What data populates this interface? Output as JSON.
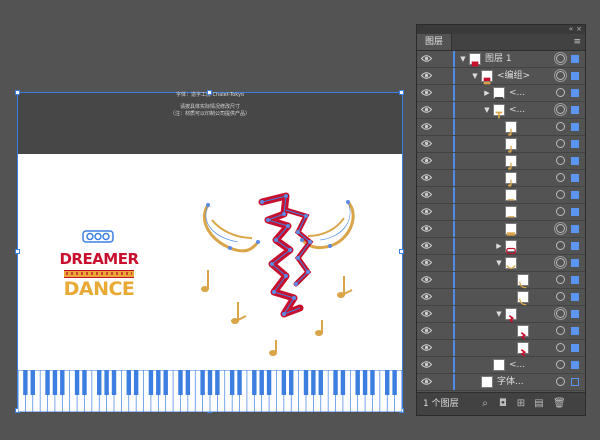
{
  "artboard": {
    "annotation_line1": "字体：造字工房 Chalet-Tokyo",
    "annotation_line2": "请按具体实际情况修改尺寸",
    "annotation_line3": "（注：材质可以印制公司提供产品）",
    "logo_text_top": "DREAMER",
    "logo_text_bottom": "DANCE",
    "colors": {
      "selection": "#3d7fe0",
      "logo_red": "#c8102e",
      "logo_gold": "#e8a935",
      "wing_gold": "#d9a548"
    }
  },
  "layers_panel": {
    "tab_label": "图层",
    "collapse_icon": "«",
    "close_icon": "×",
    "menu_icon": "≡",
    "layers": [
      {
        "indent": 0,
        "expand": "open",
        "name": "图层 1",
        "thumb": "layer",
        "target": "double",
        "selected": "filled"
      },
      {
        "indent": 1,
        "expand": "open",
        "name": "<编组>",
        "thumb": "group",
        "target": "double",
        "selected": "filled"
      },
      {
        "indent": 2,
        "expand": "closed",
        "name": "<...",
        "thumb": "line",
        "target": "single",
        "selected": "filled"
      },
      {
        "indent": 2,
        "expand": "open",
        "name": "<...",
        "thumb": "art",
        "target": "double",
        "selected": "filled"
      },
      {
        "indent": 3,
        "expand": "",
        "name": "",
        "thumb": "note",
        "target": "single",
        "selected": "filled"
      },
      {
        "indent": 3,
        "expand": "",
        "name": "",
        "thumb": "note",
        "target": "single",
        "selected": "filled"
      },
      {
        "indent": 3,
        "expand": "",
        "name": "",
        "thumb": "note",
        "target": "single",
        "selected": "filled"
      },
      {
        "indent": 3,
        "expand": "",
        "name": "",
        "thumb": "note",
        "target": "single",
        "selected": "filled"
      },
      {
        "indent": 3,
        "expand": "",
        "name": "",
        "thumb": "dash",
        "target": "single",
        "selected": "filled"
      },
      {
        "indent": 3,
        "expand": "",
        "name": "",
        "thumb": "dash",
        "target": "single",
        "selected": "filled"
      },
      {
        "indent": 3,
        "expand": "",
        "name": "",
        "thumb": "strip",
        "target": "double",
        "selected": "filled"
      },
      {
        "indent": 3,
        "expand": "closed",
        "name": "",
        "thumb": "logo",
        "target": "single",
        "selected": "filled"
      },
      {
        "indent": 3,
        "expand": "open",
        "name": "",
        "thumb": "wings",
        "target": "double",
        "selected": "filled"
      },
      {
        "indent": 4,
        "expand": "",
        "name": "",
        "thumb": "wing",
        "target": "single",
        "selected": "filled"
      },
      {
        "indent": 4,
        "expand": "",
        "name": "",
        "thumb": "wing",
        "target": "single",
        "selected": "filled"
      },
      {
        "indent": 3,
        "expand": "open",
        "name": "",
        "thumb": "dancer",
        "target": "double",
        "selected": "filled"
      },
      {
        "indent": 4,
        "expand": "",
        "name": "",
        "thumb": "dancer",
        "target": "single",
        "selected": "filled"
      },
      {
        "indent": 4,
        "expand": "",
        "name": "",
        "thumb": "dancer",
        "target": "single",
        "selected": "filled"
      },
      {
        "indent": 2,
        "expand": "",
        "name": "<...",
        "thumb": "blank",
        "target": "single",
        "selected": "filled"
      },
      {
        "indent": 1,
        "expand": "",
        "name": "字体...",
        "thumb": "blank",
        "target": "single",
        "selected": "outline"
      }
    ],
    "footer_label": "1 个图层",
    "footer_icons": [
      "search-icon",
      "make-clipping-mask-icon",
      "create-sublayer-icon",
      "new-layer-icon",
      "delete-icon"
    ]
  }
}
